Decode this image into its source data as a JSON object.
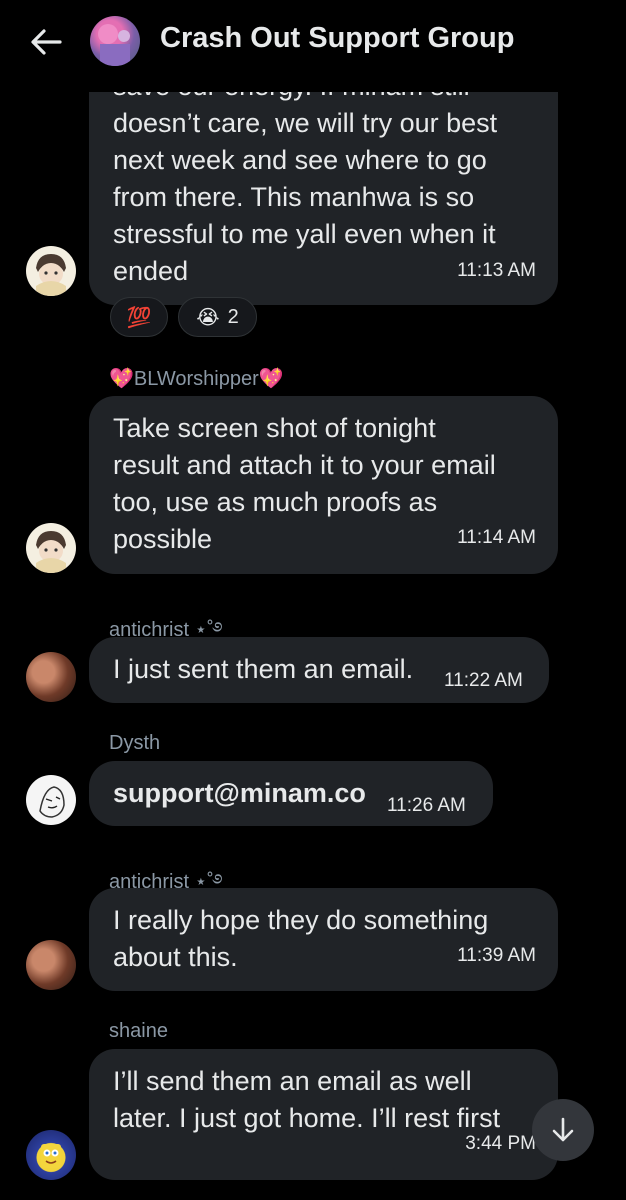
{
  "header": {
    "title": "Crash Out Support Group",
    "back_icon": "arrow-left-icon",
    "avatar": "group-avatar"
  },
  "messages": [
    {
      "lines": [
        "save our energy. If minam still",
        "doesn’t care, we will try our best",
        "next week and see where to go",
        "from there. This manhwa is so",
        "stressful to me yall even when it",
        "ended"
      ],
      "time": "11:13 AM"
    },
    {
      "sender": "💖BLWorshipper💖",
      "lines": [
        "Take screen shot of tonight",
        "result and attach it to your email",
        "too, use as much proofs as",
        "possible"
      ],
      "time": "11:14 AM"
    },
    {
      "sender": "antichrist ⋆˚࿔",
      "lines": [
        "I just sent them an email."
      ],
      "time": "11:22 AM"
    },
    {
      "sender": "Dysth",
      "lines": [
        "support@minam.co"
      ],
      "time": "11:26 AM"
    },
    {
      "sender": "antichrist ⋆˚࿔",
      "lines": [
        "I really hope they do something",
        "about this."
      ],
      "time": "11:39 AM"
    },
    {
      "sender": "shaine",
      "lines": [
        "I’ll send them an email as well",
        "later. I just got home. I’ll rest first"
      ],
      "time": "3:44 PM"
    }
  ],
  "reactions": [
    {
      "emoji": "💯",
      "count": ""
    },
    {
      "emoji": "😭",
      "count": "2"
    }
  ],
  "scroll_button": {
    "icon": "arrow-down-icon"
  },
  "colors": {
    "background": "#000000",
    "bubble": "#202327",
    "text": "#e7e9ea",
    "sender": "#8b98a5"
  }
}
